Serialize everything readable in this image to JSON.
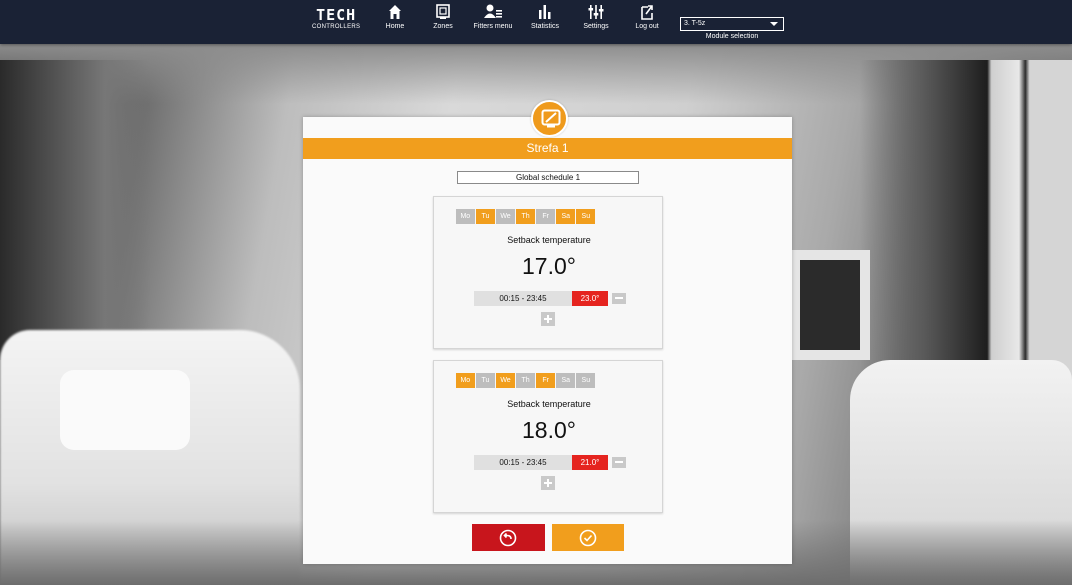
{
  "brand": {
    "line1": "TECH",
    "line2": "CONTROLLERS"
  },
  "nav": [
    {
      "label": "Home",
      "icon": "home-icon"
    },
    {
      "label": "Zones",
      "icon": "zones-icon"
    },
    {
      "label": "Fitters menu",
      "icon": "fitters-menu-icon"
    },
    {
      "label": "Statistics",
      "icon": "statistics-icon"
    },
    {
      "label": "Settings",
      "icon": "settings-icon"
    },
    {
      "label": "Log out",
      "icon": "logout-icon"
    }
  ],
  "module": {
    "selected": "3. T-5z",
    "label": "Module selection"
  },
  "panel": {
    "title": "Strefa 1",
    "schedule": "Global schedule 1"
  },
  "cards": [
    {
      "days": [
        {
          "label": "Mo",
          "active": false
        },
        {
          "label": "Tu",
          "active": true
        },
        {
          "label": "We",
          "active": false
        },
        {
          "label": "Th",
          "active": true
        },
        {
          "label": "Fr",
          "active": false
        },
        {
          "label": "Sa",
          "active": true
        },
        {
          "label": "Su",
          "active": true
        }
      ],
      "label": "Setback temperature",
      "temperature": "17.0°",
      "interval": "00:15  -  23:45",
      "interval_temp": "23.0°"
    },
    {
      "days": [
        {
          "label": "Mo",
          "active": true
        },
        {
          "label": "Tu",
          "active": false
        },
        {
          "label": "We",
          "active": true
        },
        {
          "label": "Th",
          "active": false
        },
        {
          "label": "Fr",
          "active": true
        },
        {
          "label": "Sa",
          "active": false
        },
        {
          "label": "Su",
          "active": false
        }
      ],
      "label": "Setback temperature",
      "temperature": "18.0°",
      "interval": "00:15  -  23:45",
      "interval_temp": "21.0°"
    }
  ],
  "colors": {
    "accent": "#f19e1d",
    "nav_bg": "#1a2235",
    "danger": "#c8151c",
    "interval_temp": "#e5241f",
    "inactive_day": "#bdbdbd"
  }
}
